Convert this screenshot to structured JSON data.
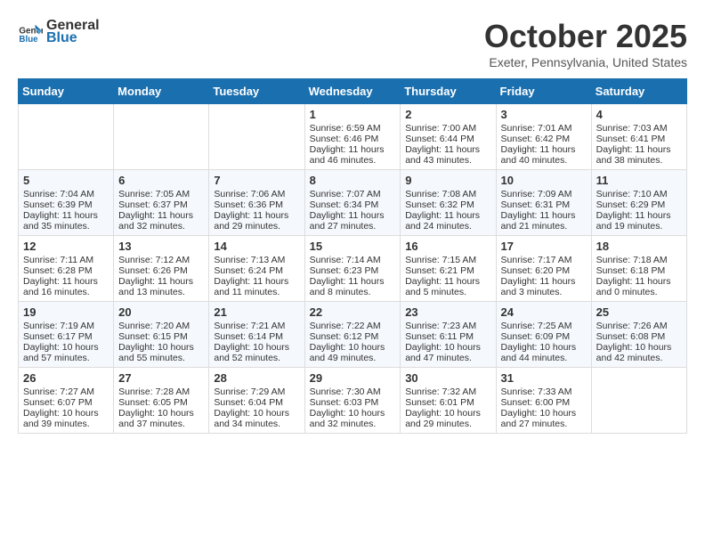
{
  "logo": {
    "text_general": "General",
    "text_blue": "Blue"
  },
  "title": "October 2025",
  "location": "Exeter, Pennsylvania, United States",
  "days_of_week": [
    "Sunday",
    "Monday",
    "Tuesday",
    "Wednesday",
    "Thursday",
    "Friday",
    "Saturday"
  ],
  "weeks": [
    [
      {
        "day": "",
        "info": ""
      },
      {
        "day": "",
        "info": ""
      },
      {
        "day": "",
        "info": ""
      },
      {
        "day": "1",
        "info": "Sunrise: 6:59 AM\nSunset: 6:46 PM\nDaylight: 11 hours\nand 46 minutes."
      },
      {
        "day": "2",
        "info": "Sunrise: 7:00 AM\nSunset: 6:44 PM\nDaylight: 11 hours\nand 43 minutes."
      },
      {
        "day": "3",
        "info": "Sunrise: 7:01 AM\nSunset: 6:42 PM\nDaylight: 11 hours\nand 40 minutes."
      },
      {
        "day": "4",
        "info": "Sunrise: 7:03 AM\nSunset: 6:41 PM\nDaylight: 11 hours\nand 38 minutes."
      }
    ],
    [
      {
        "day": "5",
        "info": "Sunrise: 7:04 AM\nSunset: 6:39 PM\nDaylight: 11 hours\nand 35 minutes."
      },
      {
        "day": "6",
        "info": "Sunrise: 7:05 AM\nSunset: 6:37 PM\nDaylight: 11 hours\nand 32 minutes."
      },
      {
        "day": "7",
        "info": "Sunrise: 7:06 AM\nSunset: 6:36 PM\nDaylight: 11 hours\nand 29 minutes."
      },
      {
        "day": "8",
        "info": "Sunrise: 7:07 AM\nSunset: 6:34 PM\nDaylight: 11 hours\nand 27 minutes."
      },
      {
        "day": "9",
        "info": "Sunrise: 7:08 AM\nSunset: 6:32 PM\nDaylight: 11 hours\nand 24 minutes."
      },
      {
        "day": "10",
        "info": "Sunrise: 7:09 AM\nSunset: 6:31 PM\nDaylight: 11 hours\nand 21 minutes."
      },
      {
        "day": "11",
        "info": "Sunrise: 7:10 AM\nSunset: 6:29 PM\nDaylight: 11 hours\nand 19 minutes."
      }
    ],
    [
      {
        "day": "12",
        "info": "Sunrise: 7:11 AM\nSunset: 6:28 PM\nDaylight: 11 hours\nand 16 minutes."
      },
      {
        "day": "13",
        "info": "Sunrise: 7:12 AM\nSunset: 6:26 PM\nDaylight: 11 hours\nand 13 minutes."
      },
      {
        "day": "14",
        "info": "Sunrise: 7:13 AM\nSunset: 6:24 PM\nDaylight: 11 hours\nand 11 minutes."
      },
      {
        "day": "15",
        "info": "Sunrise: 7:14 AM\nSunset: 6:23 PM\nDaylight: 11 hours\nand 8 minutes."
      },
      {
        "day": "16",
        "info": "Sunrise: 7:15 AM\nSunset: 6:21 PM\nDaylight: 11 hours\nand 5 minutes."
      },
      {
        "day": "17",
        "info": "Sunrise: 7:17 AM\nSunset: 6:20 PM\nDaylight: 11 hours\nand 3 minutes."
      },
      {
        "day": "18",
        "info": "Sunrise: 7:18 AM\nSunset: 6:18 PM\nDaylight: 11 hours\nand 0 minutes."
      }
    ],
    [
      {
        "day": "19",
        "info": "Sunrise: 7:19 AM\nSunset: 6:17 PM\nDaylight: 10 hours\nand 57 minutes."
      },
      {
        "day": "20",
        "info": "Sunrise: 7:20 AM\nSunset: 6:15 PM\nDaylight: 10 hours\nand 55 minutes."
      },
      {
        "day": "21",
        "info": "Sunrise: 7:21 AM\nSunset: 6:14 PM\nDaylight: 10 hours\nand 52 minutes."
      },
      {
        "day": "22",
        "info": "Sunrise: 7:22 AM\nSunset: 6:12 PM\nDaylight: 10 hours\nand 49 minutes."
      },
      {
        "day": "23",
        "info": "Sunrise: 7:23 AM\nSunset: 6:11 PM\nDaylight: 10 hours\nand 47 minutes."
      },
      {
        "day": "24",
        "info": "Sunrise: 7:25 AM\nSunset: 6:09 PM\nDaylight: 10 hours\nand 44 minutes."
      },
      {
        "day": "25",
        "info": "Sunrise: 7:26 AM\nSunset: 6:08 PM\nDaylight: 10 hours\nand 42 minutes."
      }
    ],
    [
      {
        "day": "26",
        "info": "Sunrise: 7:27 AM\nSunset: 6:07 PM\nDaylight: 10 hours\nand 39 minutes."
      },
      {
        "day": "27",
        "info": "Sunrise: 7:28 AM\nSunset: 6:05 PM\nDaylight: 10 hours\nand 37 minutes."
      },
      {
        "day": "28",
        "info": "Sunrise: 7:29 AM\nSunset: 6:04 PM\nDaylight: 10 hours\nand 34 minutes."
      },
      {
        "day": "29",
        "info": "Sunrise: 7:30 AM\nSunset: 6:03 PM\nDaylight: 10 hours\nand 32 minutes."
      },
      {
        "day": "30",
        "info": "Sunrise: 7:32 AM\nSunset: 6:01 PM\nDaylight: 10 hours\nand 29 minutes."
      },
      {
        "day": "31",
        "info": "Sunrise: 7:33 AM\nSunset: 6:00 PM\nDaylight: 10 hours\nand 27 minutes."
      },
      {
        "day": "",
        "info": ""
      }
    ]
  ]
}
